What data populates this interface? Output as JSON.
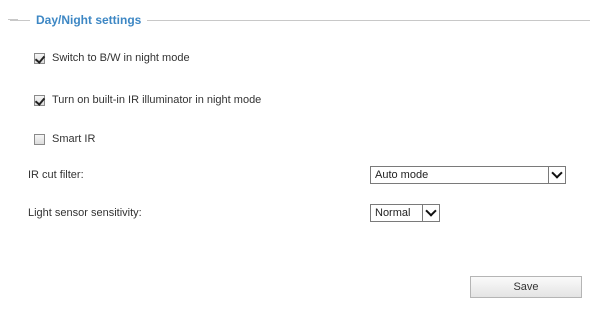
{
  "section": {
    "title": "Day/Night settings"
  },
  "options": {
    "switch_bw": {
      "label": "Switch to B/W in night mode",
      "checked": true
    },
    "ir_illuminator": {
      "label": "Turn on built-in IR illuminator in night mode",
      "checked": true
    },
    "smart_ir": {
      "label": "Smart IR",
      "checked": false
    }
  },
  "ir_cut_filter": {
    "label": "IR cut filter:",
    "selected": "Auto mode"
  },
  "light_sensor": {
    "label": "Light sensor sensitivity:",
    "selected": "Normal"
  },
  "actions": {
    "save_label": "Save"
  }
}
